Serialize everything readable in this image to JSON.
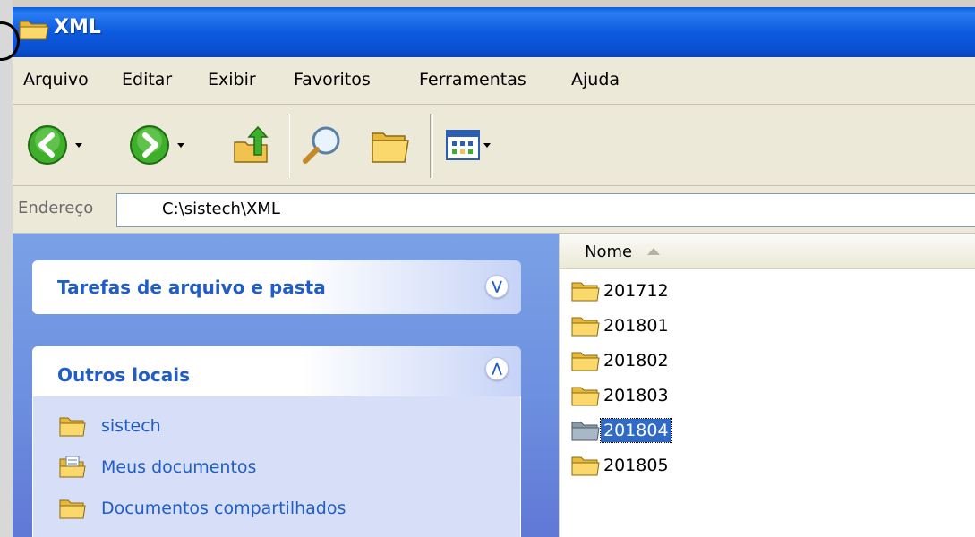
{
  "window": {
    "title": "XML"
  },
  "menu": {
    "items": [
      {
        "label": "Arquivo"
      },
      {
        "label": "Editar"
      },
      {
        "label": "Exibir"
      },
      {
        "label": "Favoritos"
      },
      {
        "label": "Ferramentas"
      },
      {
        "label": "Ajuda"
      }
    ]
  },
  "toolbar": {
    "buttons": [
      "back-icon",
      "forward-icon",
      "up-folder-icon",
      "search-icon",
      "folders-icon",
      "views-icon"
    ]
  },
  "address": {
    "label": "Endereço",
    "value": "C:\\sistech\\XML"
  },
  "tasks": {
    "file_folder_tasks": {
      "title": "Tarefas de arquivo e pasta",
      "expanded": false
    },
    "other_places": {
      "title": "Outros locais",
      "expanded": true,
      "items": [
        {
          "label": "sistech",
          "icon": "folder-icon"
        },
        {
          "label": "Meus documentos",
          "icon": "my-documents-icon"
        },
        {
          "label": "Documentos compartilhados",
          "icon": "folder-icon"
        }
      ]
    }
  },
  "file_list": {
    "column_header": "Nome",
    "sort": "ascending",
    "items": [
      {
        "name": "201712",
        "selected": false
      },
      {
        "name": "201801",
        "selected": false
      },
      {
        "name": "201802",
        "selected": false
      },
      {
        "name": "201803",
        "selected": false
      },
      {
        "name": "201804",
        "selected": true
      },
      {
        "name": "201805",
        "selected": false
      }
    ]
  },
  "colors": {
    "title_bar": "#0a5fe0",
    "task_pane": "#7aa1e6",
    "task_link": "#215dc6",
    "selection": "#316ac5",
    "folder": "#f6c644"
  }
}
